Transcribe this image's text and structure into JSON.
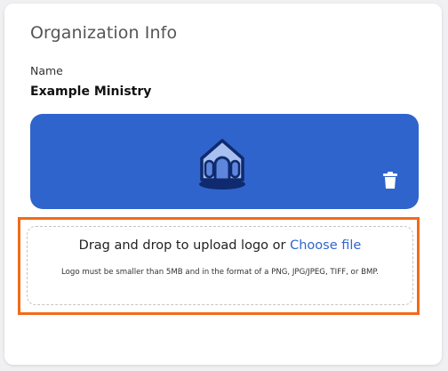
{
  "section": {
    "title": "Organization Info"
  },
  "name_field": {
    "label": "Name",
    "value": "Example Ministry"
  },
  "logo": {
    "icon": "church-icon",
    "delete_icon": "trash-icon",
    "background_color": "#2f64cc"
  },
  "upload": {
    "prompt": "Drag and drop to upload logo or",
    "link": "Choose file",
    "note": "Logo must be smaller than 5MB and in the format of a PNG, JPG/JPEG, TIFF, or BMP.",
    "highlight_color": "#f26a1b"
  }
}
